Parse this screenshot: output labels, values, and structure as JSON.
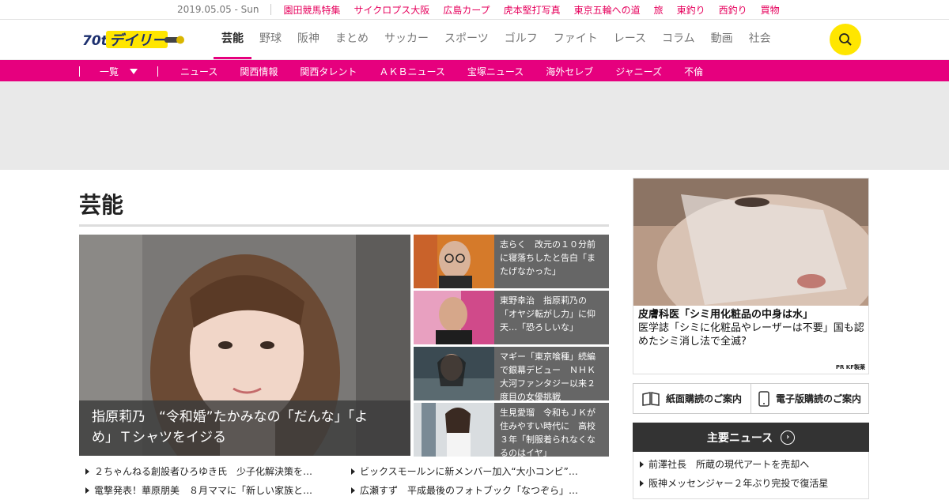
{
  "topbar": {
    "date": "2019.05.05 - Sun",
    "links": [
      "園田競馬特集",
      "サイクロプス大阪",
      "広島カープ",
      "虎本堅打写真",
      "東京五輪への道",
      "旅",
      "東釣り",
      "西釣り",
      "買物"
    ]
  },
  "logo": {
    "text": "デイリー",
    "badge": "70th"
  },
  "nav": [
    "芸能",
    "野球",
    "阪神",
    "まとめ",
    "サッカー",
    "スポーツ",
    "ゴルフ",
    "ファイト",
    "レース",
    "コラム",
    "動画",
    "社会"
  ],
  "subnav": {
    "dropdown": "一覧",
    "items": [
      "ニュース",
      "関西情報",
      "関西タレント",
      "ＡＫＢニュース",
      "宝塚ニュース",
      "海外セレブ",
      "ジャニーズ",
      "不倫"
    ]
  },
  "section_title": "芸能",
  "hero": {
    "caption_line1": "指原莉乃　“令和婚”たかみなの「だんな」「よ",
    "caption_line2": "め」Ｔシャツをイジる"
  },
  "side_articles": [
    {
      "text": "志らく　改元の１０分前に寝落ちしたと告白「またげなかった」"
    },
    {
      "text": "東野幸治　指原莉乃の「オヤジ転がし力」に仰天…「恐ろしいな」"
    },
    {
      "text": "マギー「東京喰種」続編で銀幕デビュー　ＮＨＫ大河ファンタジー以来２度目の女優挑戦"
    },
    {
      "text": "生見愛瑠　令和もＪＫが住みやすい時代に　高校３年「制服着られなくなるのはイヤ」"
    }
  ],
  "list_left": [
    "２ちゃんねる創設者ひろゆき氏　少子化解決策を…",
    "電撃発表！華原朋美　８月ママに「新しい家族と…"
  ],
  "list_right": [
    "ビックスモールンに新メンバー加入“大小コンビ”…",
    "広瀬すず　平成最後のフォトブック「なつぞら」…"
  ],
  "ad": {
    "headline": "皮膚科医「シミ用化粧品の中身は水」",
    "body": "医学誌「シミに化粧品やレーザーは不要」国も認めたシミ消し法で全滅?",
    "pr": "PR KF製薬"
  },
  "subscribe": {
    "paper": "紙面購読のご案内",
    "digital": "電子版購読のご案内"
  },
  "major_news": {
    "title": "主要ニュース",
    "items": [
      "前澤社長　所蔵の現代アートを売却へ",
      "阪神メッセンジャー２年ぶり完投で復活星"
    ]
  },
  "colors": {
    "accent": "#e6007e",
    "search": "#ffe600",
    "dark": "#333333"
  }
}
